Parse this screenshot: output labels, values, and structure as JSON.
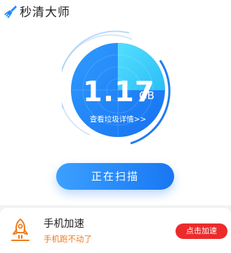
{
  "header": {
    "app_title": "秒清大师",
    "logo_icon": "broom-icon"
  },
  "scan_panel": {
    "junk_size": "1.17",
    "junk_unit": "GB",
    "detail_link": "查看垃圾详情>>",
    "scan_progress": 0.25,
    "scan_button": "正在扫描"
  },
  "feature_card": {
    "icon": "rocket-icon",
    "title": "手机加速",
    "subtitle": "手机跑不动了",
    "action_button": "点击加速"
  },
  "colors": {
    "primary_blue": "#1877f2",
    "light_blue": "#3ba0ff",
    "cyan": "#35d7ff",
    "accent_orange": "#f07c1b",
    "accent_red": "#ec2b2b"
  }
}
